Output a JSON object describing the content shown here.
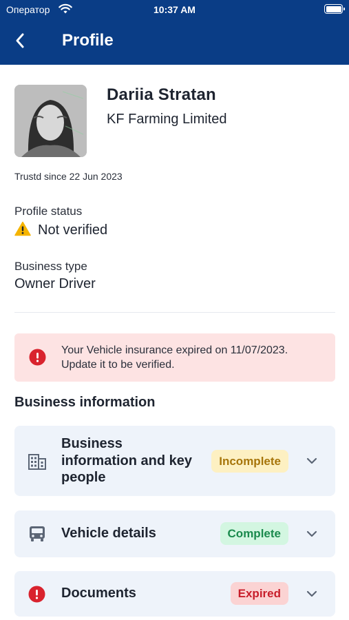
{
  "status_bar": {
    "carrier": "Оператор",
    "time": "10:37 AM"
  },
  "header": {
    "title": "Profile"
  },
  "profile": {
    "name": "Dariia Stratan",
    "company": "KF Farming Limited",
    "since": "Trustd since 22 Jun 2023",
    "status_label": "Profile status",
    "status_value": "Not verified",
    "business_type_label": "Business type",
    "business_type_value": "Owner Driver"
  },
  "alert": {
    "text": "Your Vehicle insurance expired on 11/07/2023. Update it to be verified."
  },
  "business_section": {
    "title": "Business information",
    "cards": [
      {
        "title": "Business information and key people",
        "badge": "Incomplete",
        "icon": "building-icon"
      },
      {
        "title": "Vehicle details",
        "badge": "Complete",
        "icon": "truck-icon"
      },
      {
        "title": "Documents",
        "badge": "Expired",
        "icon": "error-icon"
      }
    ]
  },
  "colors": {
    "header_bg": "#0a3d86",
    "warning": "#f5b400",
    "error": "#d9232e",
    "alert_bg": "#fde3e3",
    "card_bg": "#eef3fa",
    "incomplete_bg": "#fdf0c2",
    "incomplete_text": "#a7750a",
    "complete_bg": "#d3f6e1",
    "complete_text": "#1a8a4d",
    "expired_bg": "#fbd3d3",
    "expired_text": "#c81e2b"
  }
}
